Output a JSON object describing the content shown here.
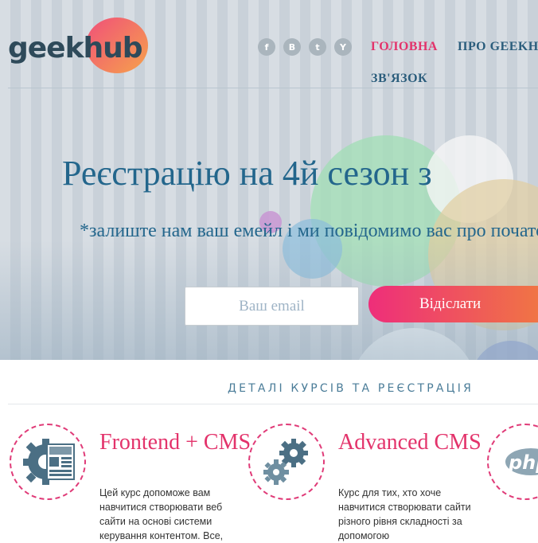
{
  "logo": {
    "part1": "geek",
    "part2": "hub"
  },
  "social": [
    {
      "name": "facebook-icon",
      "glyph": "f"
    },
    {
      "name": "vk-icon",
      "glyph": "В"
    },
    {
      "name": "twitter-icon",
      "glyph": "t"
    },
    {
      "name": "youtube-icon",
      "glyph": "Y"
    }
  ],
  "nav": {
    "home": "ГОЛОВНА",
    "about": "ПРО GEEKHUB",
    "contact": "ЗВ'ЯЗОК"
  },
  "hero": {
    "title": "Реєстрацію на 4й сезон з",
    "subtitle": "*залиште нам ваш емейл і ми повідомимо вас про початок реєстрації",
    "email_placeholder": "Ваш email",
    "send_label": "Відіслати"
  },
  "section": {
    "title": "ДЕТАЛІ КУРСІВ ТА РЕЄСТРАЦІЯ"
  },
  "courses": [
    {
      "title": "Frontend + CMS",
      "desc": "Цей курс допоможе вам навчитися створювати веб сайти на основі системи керування контентом. Все,"
    },
    {
      "title": "Advanced CMS",
      "desc": "Курс для тих, хто хоче навчитися створювати сайти різного рівня складності за допомогою"
    },
    {
      "title": "",
      "desc": ""
    }
  ],
  "colors": {
    "accent": "#e3336b",
    "nav": "#2b5d7c",
    "hero_text": "#23668c"
  }
}
